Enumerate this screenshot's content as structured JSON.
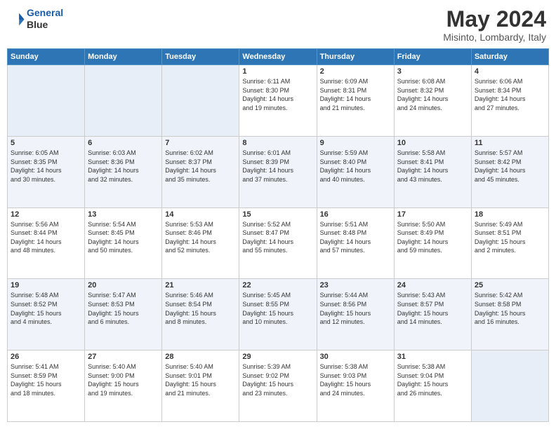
{
  "header": {
    "logo_line1": "General",
    "logo_line2": "Blue",
    "title": "May 2024",
    "subtitle": "Misinto, Lombardy, Italy"
  },
  "weekdays": [
    "Sunday",
    "Monday",
    "Tuesday",
    "Wednesday",
    "Thursday",
    "Friday",
    "Saturday"
  ],
  "weeks": [
    [
      {
        "day": "",
        "info": ""
      },
      {
        "day": "",
        "info": ""
      },
      {
        "day": "",
        "info": ""
      },
      {
        "day": "1",
        "info": "Sunrise: 6:11 AM\nSunset: 8:30 PM\nDaylight: 14 hours\nand 19 minutes."
      },
      {
        "day": "2",
        "info": "Sunrise: 6:09 AM\nSunset: 8:31 PM\nDaylight: 14 hours\nand 21 minutes."
      },
      {
        "day": "3",
        "info": "Sunrise: 6:08 AM\nSunset: 8:32 PM\nDaylight: 14 hours\nand 24 minutes."
      },
      {
        "day": "4",
        "info": "Sunrise: 6:06 AM\nSunset: 8:34 PM\nDaylight: 14 hours\nand 27 minutes."
      }
    ],
    [
      {
        "day": "5",
        "info": "Sunrise: 6:05 AM\nSunset: 8:35 PM\nDaylight: 14 hours\nand 30 minutes."
      },
      {
        "day": "6",
        "info": "Sunrise: 6:03 AM\nSunset: 8:36 PM\nDaylight: 14 hours\nand 32 minutes."
      },
      {
        "day": "7",
        "info": "Sunrise: 6:02 AM\nSunset: 8:37 PM\nDaylight: 14 hours\nand 35 minutes."
      },
      {
        "day": "8",
        "info": "Sunrise: 6:01 AM\nSunset: 8:39 PM\nDaylight: 14 hours\nand 37 minutes."
      },
      {
        "day": "9",
        "info": "Sunrise: 5:59 AM\nSunset: 8:40 PM\nDaylight: 14 hours\nand 40 minutes."
      },
      {
        "day": "10",
        "info": "Sunrise: 5:58 AM\nSunset: 8:41 PM\nDaylight: 14 hours\nand 43 minutes."
      },
      {
        "day": "11",
        "info": "Sunrise: 5:57 AM\nSunset: 8:42 PM\nDaylight: 14 hours\nand 45 minutes."
      }
    ],
    [
      {
        "day": "12",
        "info": "Sunrise: 5:56 AM\nSunset: 8:44 PM\nDaylight: 14 hours\nand 48 minutes."
      },
      {
        "day": "13",
        "info": "Sunrise: 5:54 AM\nSunset: 8:45 PM\nDaylight: 14 hours\nand 50 minutes."
      },
      {
        "day": "14",
        "info": "Sunrise: 5:53 AM\nSunset: 8:46 PM\nDaylight: 14 hours\nand 52 minutes."
      },
      {
        "day": "15",
        "info": "Sunrise: 5:52 AM\nSunset: 8:47 PM\nDaylight: 14 hours\nand 55 minutes."
      },
      {
        "day": "16",
        "info": "Sunrise: 5:51 AM\nSunset: 8:48 PM\nDaylight: 14 hours\nand 57 minutes."
      },
      {
        "day": "17",
        "info": "Sunrise: 5:50 AM\nSunset: 8:49 PM\nDaylight: 14 hours\nand 59 minutes."
      },
      {
        "day": "18",
        "info": "Sunrise: 5:49 AM\nSunset: 8:51 PM\nDaylight: 15 hours\nand 2 minutes."
      }
    ],
    [
      {
        "day": "19",
        "info": "Sunrise: 5:48 AM\nSunset: 8:52 PM\nDaylight: 15 hours\nand 4 minutes."
      },
      {
        "day": "20",
        "info": "Sunrise: 5:47 AM\nSunset: 8:53 PM\nDaylight: 15 hours\nand 6 minutes."
      },
      {
        "day": "21",
        "info": "Sunrise: 5:46 AM\nSunset: 8:54 PM\nDaylight: 15 hours\nand 8 minutes."
      },
      {
        "day": "22",
        "info": "Sunrise: 5:45 AM\nSunset: 8:55 PM\nDaylight: 15 hours\nand 10 minutes."
      },
      {
        "day": "23",
        "info": "Sunrise: 5:44 AM\nSunset: 8:56 PM\nDaylight: 15 hours\nand 12 minutes."
      },
      {
        "day": "24",
        "info": "Sunrise: 5:43 AM\nSunset: 8:57 PM\nDaylight: 15 hours\nand 14 minutes."
      },
      {
        "day": "25",
        "info": "Sunrise: 5:42 AM\nSunset: 8:58 PM\nDaylight: 15 hours\nand 16 minutes."
      }
    ],
    [
      {
        "day": "26",
        "info": "Sunrise: 5:41 AM\nSunset: 8:59 PM\nDaylight: 15 hours\nand 18 minutes."
      },
      {
        "day": "27",
        "info": "Sunrise: 5:40 AM\nSunset: 9:00 PM\nDaylight: 15 hours\nand 19 minutes."
      },
      {
        "day": "28",
        "info": "Sunrise: 5:40 AM\nSunset: 9:01 PM\nDaylight: 15 hours\nand 21 minutes."
      },
      {
        "day": "29",
        "info": "Sunrise: 5:39 AM\nSunset: 9:02 PM\nDaylight: 15 hours\nand 23 minutes."
      },
      {
        "day": "30",
        "info": "Sunrise: 5:38 AM\nSunset: 9:03 PM\nDaylight: 15 hours\nand 24 minutes."
      },
      {
        "day": "31",
        "info": "Sunrise: 5:38 AM\nSunset: 9:04 PM\nDaylight: 15 hours\nand 26 minutes."
      },
      {
        "day": "",
        "info": ""
      }
    ]
  ]
}
